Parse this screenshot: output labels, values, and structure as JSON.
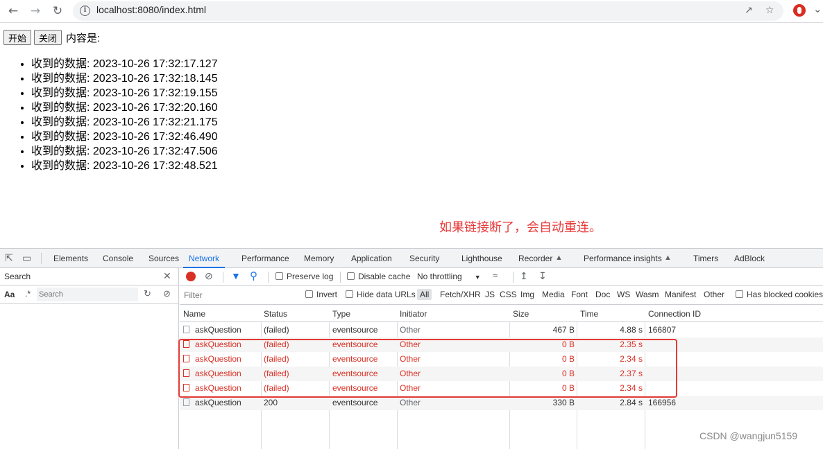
{
  "browser": {
    "url": "localhost:8080/index.html"
  },
  "page": {
    "start_button": "开始",
    "close_button": "关闭",
    "content_label": "内容是:",
    "items": [
      "收到的数据: 2023-10-26 17:32:17.127",
      "收到的数据: 2023-10-26 17:32:18.145",
      "收到的数据: 2023-10-26 17:32:19.155",
      "收到的数据: 2023-10-26 17:32:20.160",
      "收到的数据: 2023-10-26 17:32:21.175",
      "收到的数据: 2023-10-26 17:32:46.490",
      "收到的数据: 2023-10-26 17:32:47.506",
      "收到的数据: 2023-10-26 17:32:48.521"
    ],
    "annotation": "如果链接断了，会自动重连。"
  },
  "devtools": {
    "tabs": [
      "Elements",
      "Console",
      "Sources",
      "Network",
      "Performance",
      "Memory",
      "Application",
      "Security",
      "Lighthouse",
      "Recorder",
      "Performance insights",
      "Timers",
      "AdBlock"
    ],
    "active_tab": "Network",
    "search": {
      "title": "Search",
      "aa": "Aa",
      "regex": ".*",
      "placeholder": "Search"
    },
    "toolbar": {
      "preserve_log": "Preserve log",
      "disable_cache": "Disable cache",
      "throttling": "No throttling"
    },
    "filter": {
      "placeholder": "Filter",
      "invert": "Invert",
      "hide_data_urls": "Hide data URLs",
      "types": [
        "All",
        "Fetch/XHR",
        "JS",
        "CSS",
        "Img",
        "Media",
        "Font",
        "Doc",
        "WS",
        "Wasm",
        "Manifest",
        "Other"
      ],
      "blocked_cookies": "Has blocked cookies"
    },
    "table": {
      "headers": [
        "Name",
        "Status",
        "Type",
        "Initiator",
        "Size",
        "Time",
        "Connection ID"
      ],
      "rows": [
        {
          "name": "askQuestion",
          "status": "(failed)",
          "type": "eventsource",
          "initiator": "Other",
          "size": "467 B",
          "time": "4.88 s",
          "connection": "166807",
          "failed": false
        },
        {
          "name": "askQuestion",
          "status": "(failed)",
          "type": "eventsource",
          "initiator": "Other",
          "size": "0 B",
          "time": "2.35 s",
          "connection": "",
          "failed": true
        },
        {
          "name": "askQuestion",
          "status": "(failed)",
          "type": "eventsource",
          "initiator": "Other",
          "size": "0 B",
          "time": "2.34 s",
          "connection": "",
          "failed": true
        },
        {
          "name": "askQuestion",
          "status": "(failed)",
          "type": "eventsource",
          "initiator": "Other",
          "size": "0 B",
          "time": "2.37 s",
          "connection": "",
          "failed": true
        },
        {
          "name": "askQuestion",
          "status": "(failed)",
          "type": "eventsource",
          "initiator": "Other",
          "size": "0 B",
          "time": "2.34 s",
          "connection": "",
          "failed": true
        },
        {
          "name": "askQuestion",
          "status": "200",
          "type": "eventsource",
          "initiator": "Other",
          "size": "330 B",
          "time": "2.84 s",
          "connection": "166956",
          "failed": false
        }
      ]
    }
  },
  "watermark": "CSDN @wangjun5159"
}
